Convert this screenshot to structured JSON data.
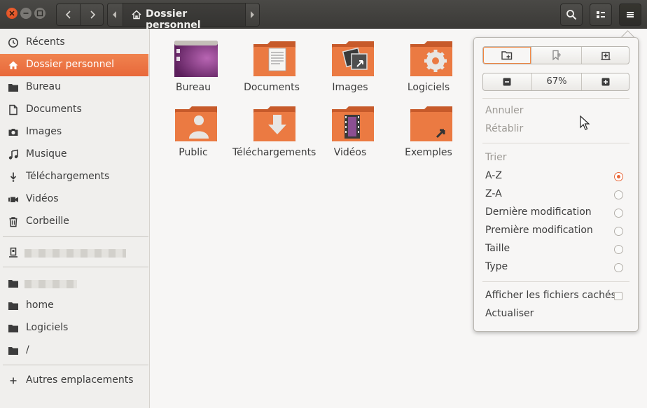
{
  "header": {
    "path_crumb": "Dossier personnel",
    "icons": [
      "close-icon",
      "minimize-icon",
      "maximize-icon",
      "back-icon",
      "forward-icon",
      "home-icon",
      "search-icon",
      "view-toggle-icon",
      "hamburger-menu-icon"
    ]
  },
  "sidebar": {
    "recent": "Récents",
    "home": "Dossier personnel",
    "desktop": "Bureau",
    "documents": "Documents",
    "pictures": "Images",
    "music": "Musique",
    "downloads": "Téléchargements",
    "videos": "Vidéos",
    "trash": "Corbeille",
    "home_dir": "home",
    "logiciels": "Logiciels",
    "root": "/",
    "other_locations": "Autres emplacements"
  },
  "files": [
    {
      "name": "Bureau",
      "icon": "desktop-folder-icon"
    },
    {
      "name": "Documents",
      "icon": "documents-folder-icon"
    },
    {
      "name": "Images",
      "icon": "pictures-folder-icon"
    },
    {
      "name": "Logiciels",
      "icon": "software-folder-icon"
    },
    {
      "name": "Public",
      "icon": "public-folder-icon"
    },
    {
      "name": "Téléchargements",
      "icon": "downloads-folder-icon"
    },
    {
      "name": "Vidéos",
      "icon": "videos-folder-icon"
    },
    {
      "name": "Exemples",
      "icon": "examples-folder-icon"
    }
  ],
  "menu": {
    "zoom": "67%",
    "undo": "Annuler",
    "redo": "Rétablir",
    "sort_header": "Trier",
    "sort_options": [
      {
        "label": "A-Z",
        "checked": true
      },
      {
        "label": "Z-A",
        "checked": false
      },
      {
        "label": "Dernière modification",
        "checked": false
      },
      {
        "label": "Première modification",
        "checked": false
      },
      {
        "label": "Taille",
        "checked": false
      },
      {
        "label": "Type",
        "checked": false
      }
    ],
    "show_hidden": "Afficher les fichiers cachés",
    "show_hidden_checked": false,
    "refresh": "Actualiser"
  },
  "colors": {
    "accent": "#e8683a",
    "header": "#3e3d39",
    "folder": "#e8743f"
  }
}
